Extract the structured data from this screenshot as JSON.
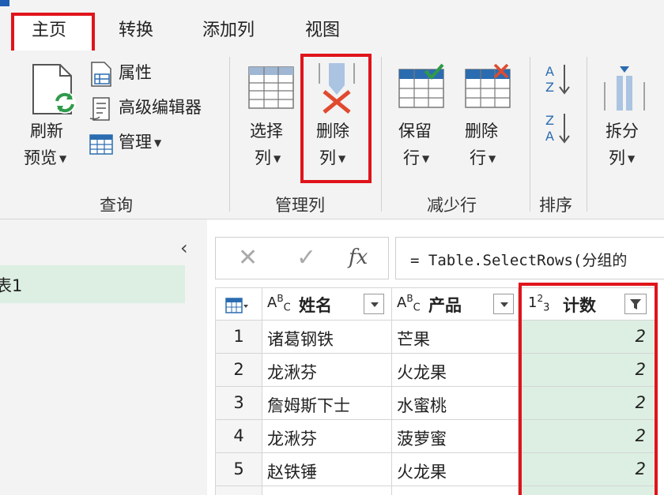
{
  "tabs": [
    "主页",
    "转换",
    "添加列",
    "视图"
  ],
  "ribbon": {
    "refresh_line1": "刷新",
    "refresh_line2": "预览",
    "properties": "属性",
    "advanced_editor": "高级编辑器",
    "manage": "管理",
    "group_query": "查询",
    "choose_col_line1": "选择",
    "choose_col_line2": "列",
    "remove_col_line1": "删除",
    "remove_col_line2": "列",
    "group_manage_cols": "管理列",
    "keep_rows_line1": "保留",
    "keep_rows_line2": "行",
    "remove_rows_line1": "删除",
    "remove_rows_line2": "行",
    "group_reduce_rows": "减少行",
    "group_sort": "排序",
    "split_col_line1": "拆分",
    "split_col_line2": "列"
  },
  "query_list": {
    "selected_item": "表1"
  },
  "formula_bar": {
    "formula": "= Table.SelectRows(分组的"
  },
  "table": {
    "columns": [
      {
        "type": "ABC",
        "name": "姓名"
      },
      {
        "type": "ABC",
        "name": "产品"
      },
      {
        "type": "123",
        "name": "计数"
      }
    ],
    "rows": [
      {
        "num": "1",
        "name": "诸葛钢铁",
        "product": "芒果",
        "count": "2"
      },
      {
        "num": "2",
        "name": "龙湫芬",
        "product": "火龙果",
        "count": "2"
      },
      {
        "num": "3",
        "name": "詹姆斯下士",
        "product": "水蜜桃",
        "count": "2"
      },
      {
        "num": "4",
        "name": "龙湫芬",
        "product": "菠萝蜜",
        "count": "2"
      },
      {
        "num": "5",
        "name": "赵铁锤",
        "product": "火龙果",
        "count": "2"
      }
    ]
  },
  "colors": {
    "highlight_red": "#e0141b",
    "selection_green": "#dcefe2",
    "accent_blue": "#1e5fb4"
  }
}
